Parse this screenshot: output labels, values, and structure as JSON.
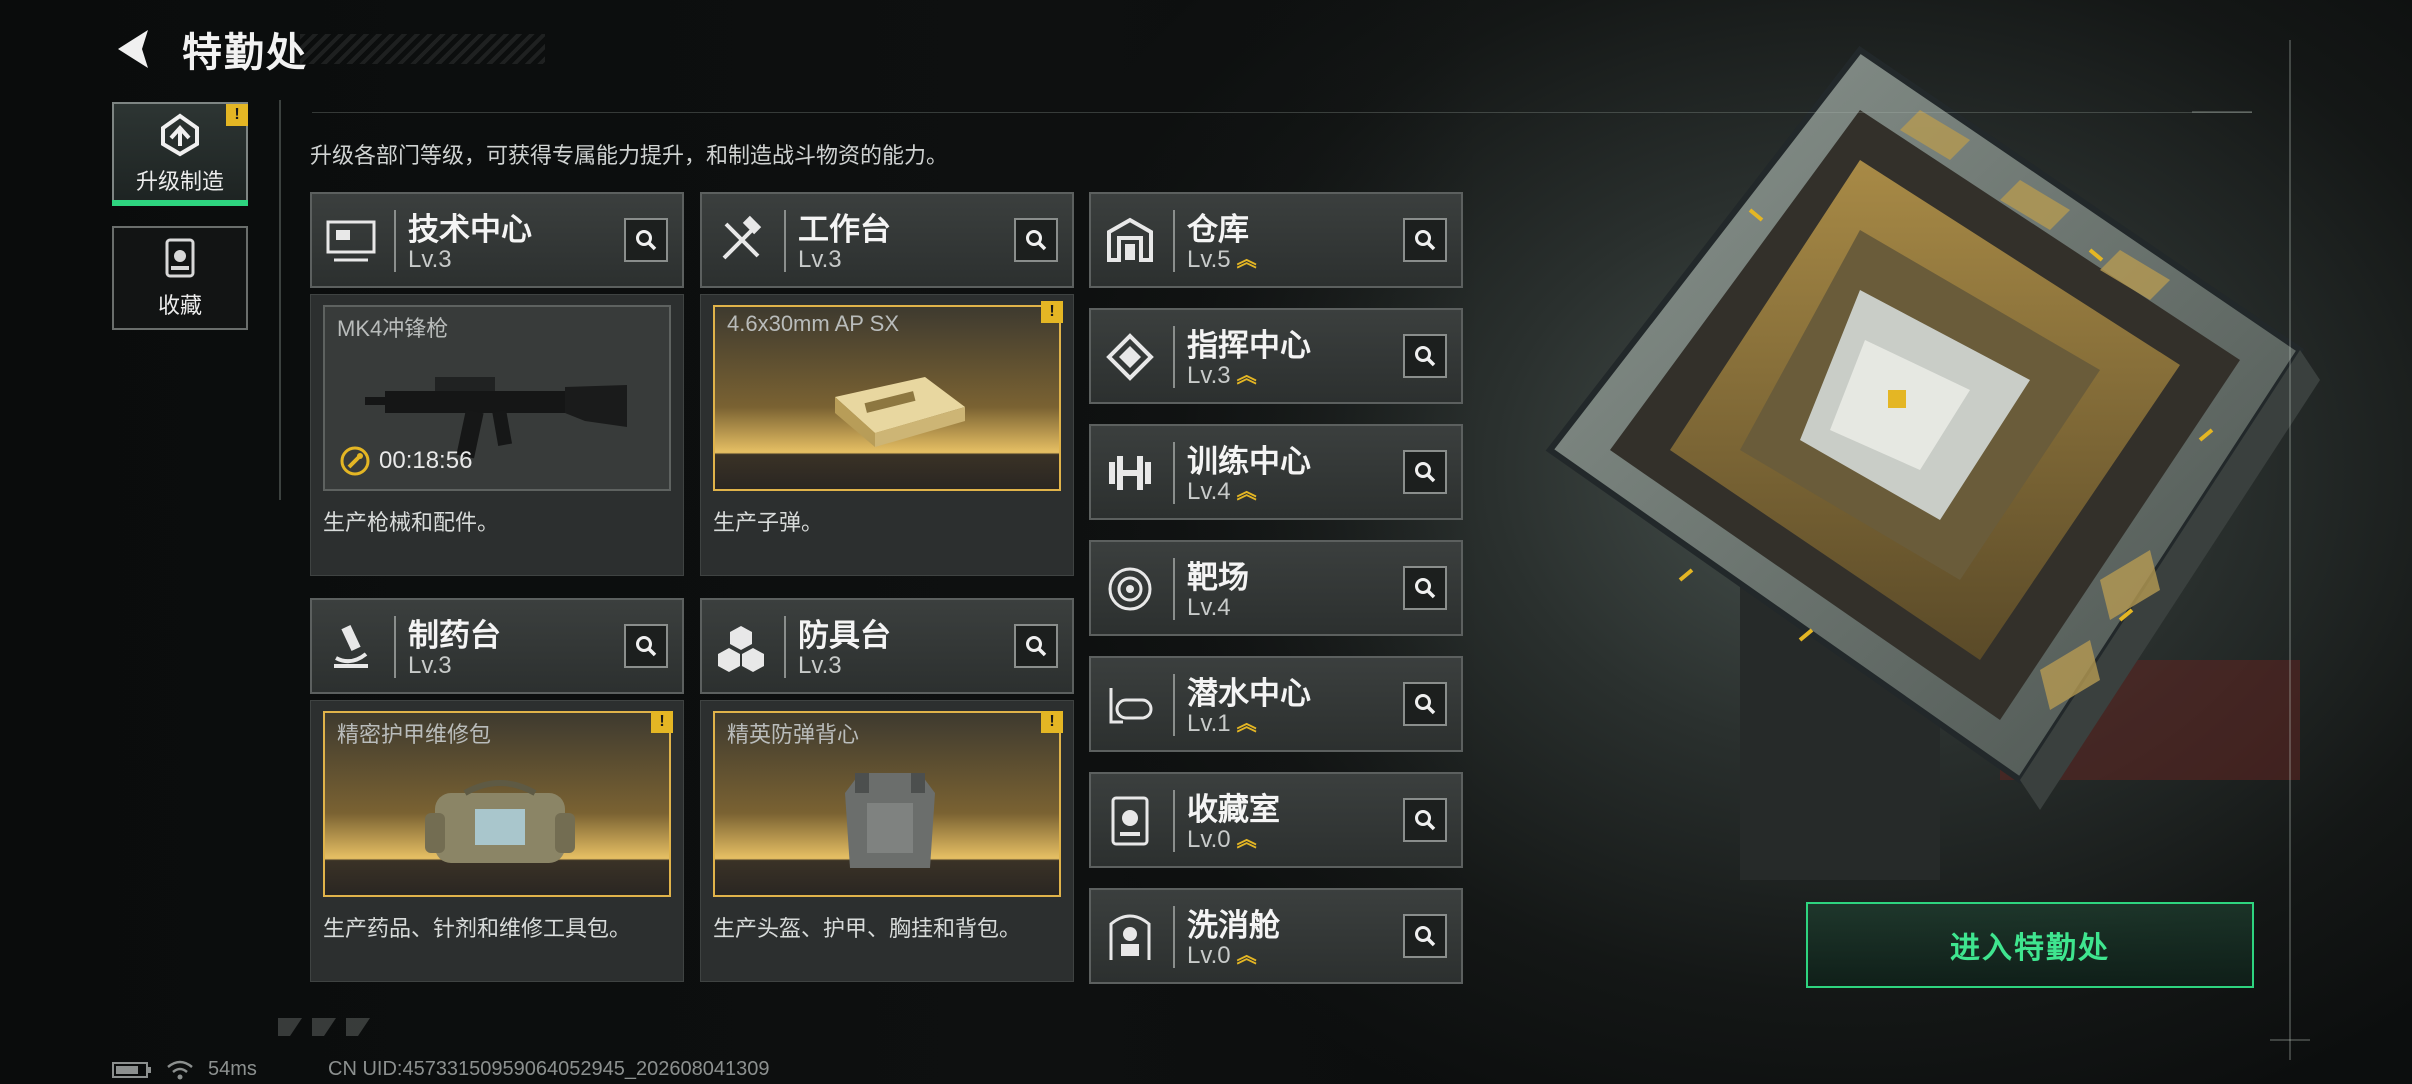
{
  "header": {
    "title": "特勤处"
  },
  "sidebar": {
    "items": [
      {
        "label": "升级制造",
        "active": true,
        "badge": "!"
      },
      {
        "label": "收藏",
        "active": false
      }
    ]
  },
  "description": "升级各部门等级，可获得专属能力提升，和制造战斗物资的能力。",
  "production": [
    {
      "dept": "技术中心",
      "level": "Lv.3",
      "item": "MK4冲锋枪",
      "timer": "00:18:56",
      "desc": "生产枪械和配件。",
      "badge": ""
    },
    {
      "dept": "工作台",
      "level": "Lv.3",
      "item": "4.6x30mm AP SX",
      "timer": "",
      "desc": "生产子弹。",
      "badge": "!"
    },
    {
      "dept": "制药台",
      "level": "Lv.3",
      "item": "精密护甲维修包",
      "timer": "",
      "desc": "生产药品、针剂和维修工具包。",
      "badge": "!"
    },
    {
      "dept": "防具台",
      "level": "Lv.3",
      "item": "精英防弹背心",
      "timer": "",
      "desc": "生产头盔、护甲、胸挂和背包。",
      "badge": "!"
    }
  ],
  "departments": [
    {
      "name": "仓库",
      "level": "Lv.5",
      "upgradable": true
    },
    {
      "name": "指挥中心",
      "level": "Lv.3",
      "upgradable": true
    },
    {
      "name": "训练中心",
      "level": "Lv.4",
      "upgradable": true
    },
    {
      "name": "靶场",
      "level": "Lv.4",
      "upgradable": false
    },
    {
      "name": "潜水中心",
      "level": "Lv.1",
      "upgradable": true
    },
    {
      "name": "收藏室",
      "level": "Lv.0",
      "upgradable": true
    },
    {
      "name": "洗消舱",
      "level": "Lv.0",
      "upgradable": true
    }
  ],
  "enter_button": "进入特勤处",
  "footer": {
    "ping": "54ms",
    "uid": "CN UID:4573315095906405​2945_202608041309"
  },
  "colors": {
    "accent_green": "#2ed47f",
    "warning_gold": "#e4b624"
  }
}
